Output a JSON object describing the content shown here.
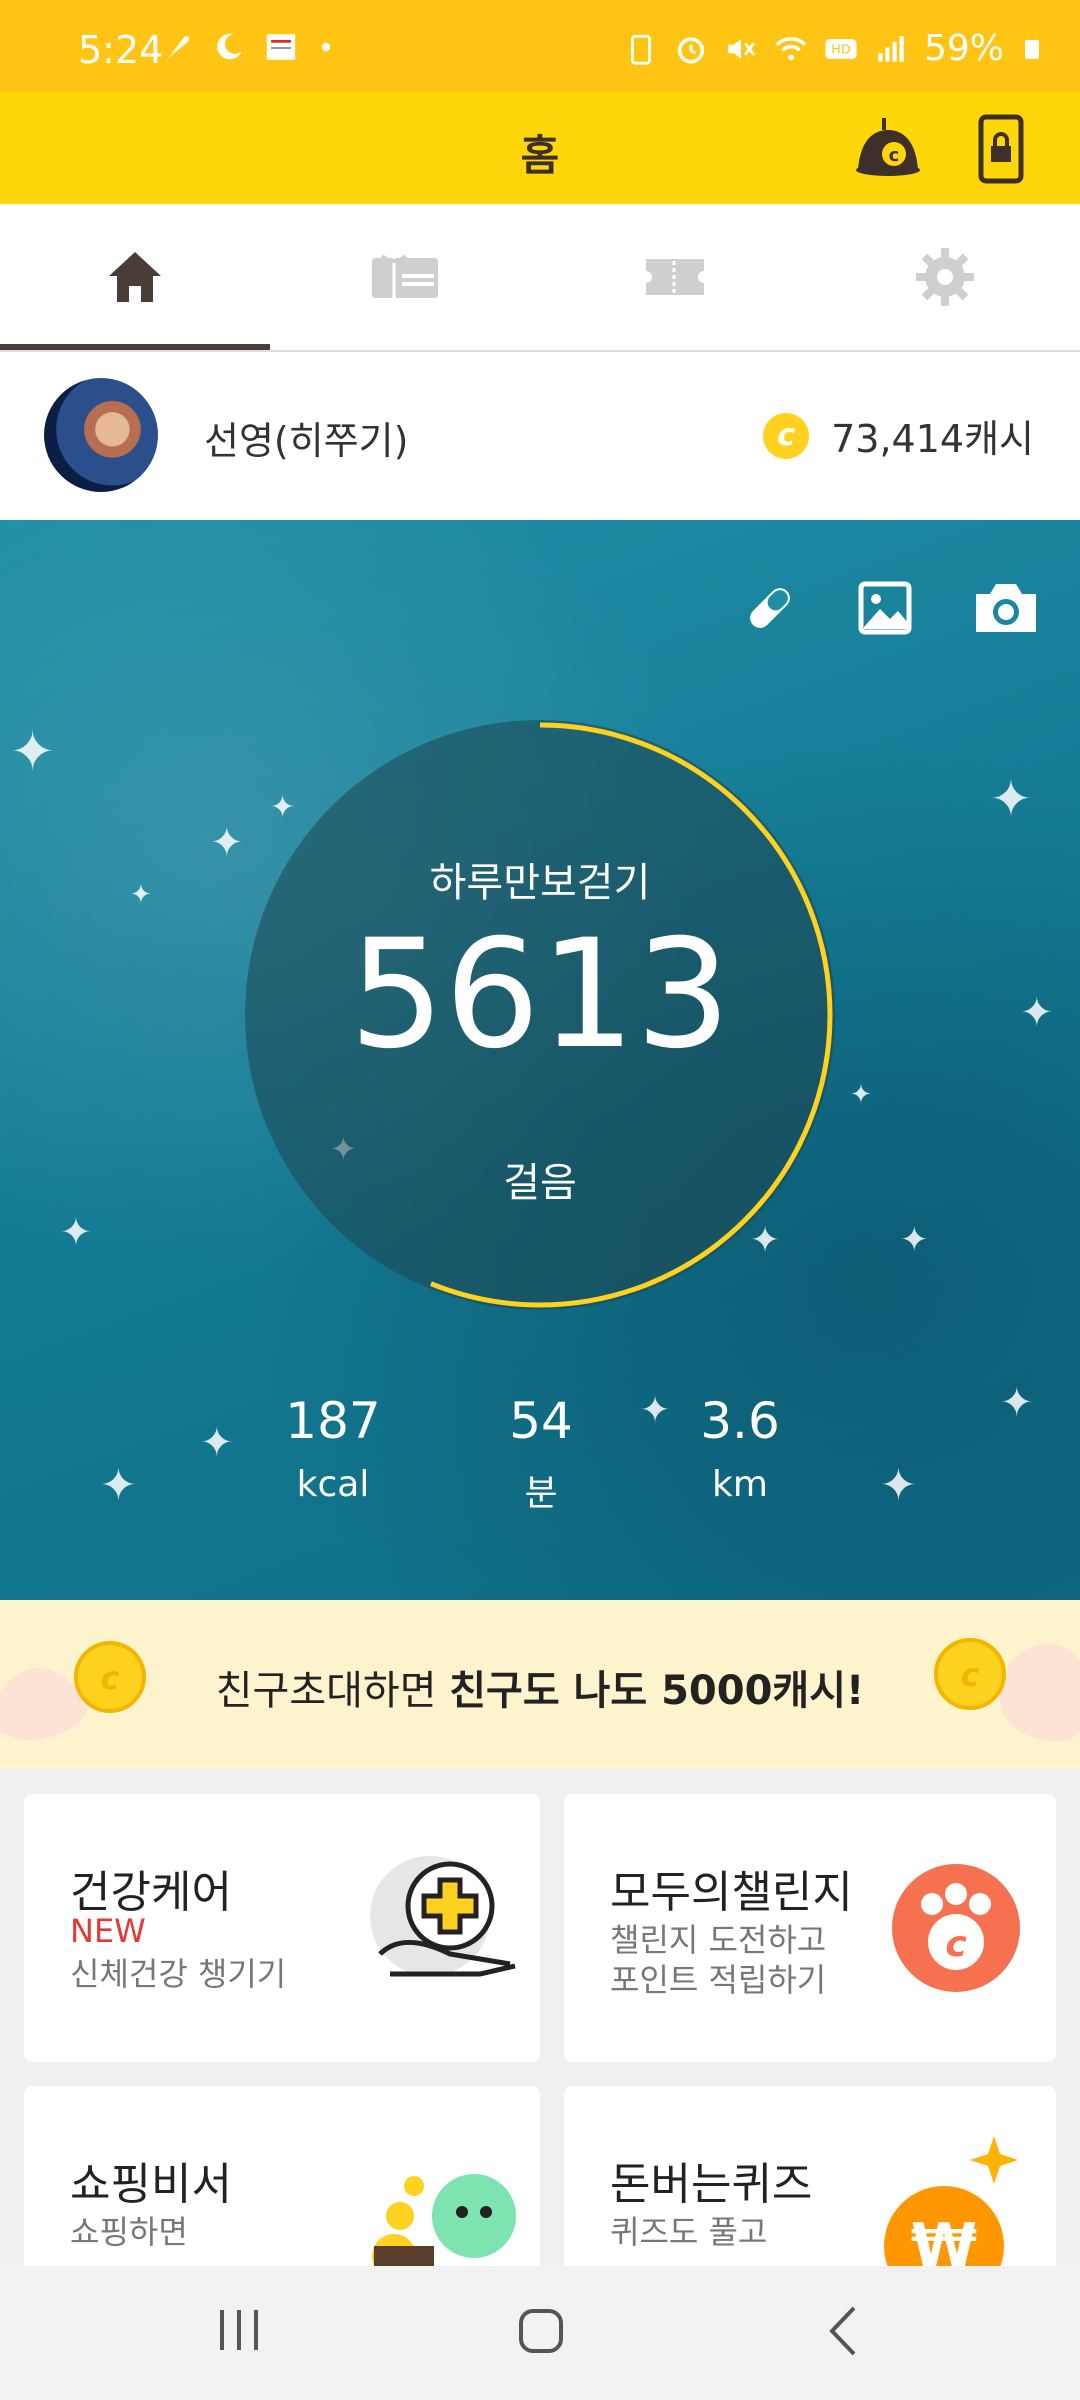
{
  "status_bar": {
    "time": "5:24",
    "battery": "59%",
    "icons": [
      "feather-icon",
      "moon-icon",
      "news-icon",
      "dot-icon",
      "battery-saver-icon",
      "alarm-icon",
      "mute-icon",
      "wifi-icon",
      "hd-voice-icon",
      "signal-icon",
      "battery-icon"
    ]
  },
  "header": {
    "title": "홈"
  },
  "tabs": [
    {
      "name": "home",
      "icon": "home-icon",
      "active": true
    },
    {
      "name": "gift",
      "icon": "gift-card-icon",
      "active": false
    },
    {
      "name": "ticket",
      "icon": "ticket-icon",
      "active": false
    },
    {
      "name": "settings",
      "icon": "gear-icon",
      "active": false
    }
  ],
  "profile": {
    "name": "선영(히쭈기)",
    "cash": "73,414캐시"
  },
  "hero": {
    "label": "하루만보걷기",
    "steps": "5613",
    "unit": "걸음",
    "progress": 0.5613,
    "stats": [
      {
        "value": "187",
        "unit": "kcal"
      },
      {
        "value": "54",
        "unit": "분"
      },
      {
        "value": "3.6",
        "unit": "km"
      }
    ]
  },
  "banner": {
    "text_normal": "친구초대하면 ",
    "text_bold": "친구도 나도 5000캐시!"
  },
  "cards": [
    {
      "title": "건강케어",
      "badge": "NEW",
      "sub": "신체건강 챙기기"
    },
    {
      "title": "모두의챌린지",
      "sub1": "챌린지 도전하고",
      "sub2": "포인트 적립하기"
    },
    {
      "title": "쇼핑비서",
      "sub1": "쇼핑하면"
    },
    {
      "title": "돈버는퀴즈",
      "sub1": "퀴즈도 풀고"
    }
  ],
  "colors": {
    "header": "#ffd60a",
    "status": "#ffc414",
    "ring": "#ffd21f",
    "accent": "#4a3d38",
    "challenge": "#f5714f"
  }
}
